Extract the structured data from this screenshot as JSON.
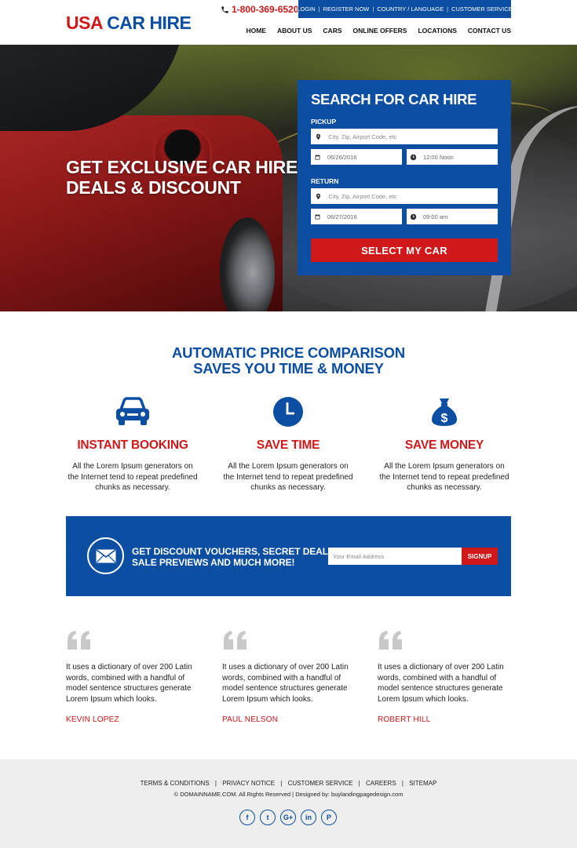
{
  "header": {
    "logo_part1": "USA",
    "logo_part2": "CAR HIRE",
    "phone": "1-800-369-6520",
    "topbar_links": [
      "LOGIN",
      "REGISTER NOW",
      "COUNTRY / LANGUAGE",
      "CUSTOMER SERVICE"
    ],
    "nav": [
      "HOME",
      "ABOUT US",
      "CARS",
      "ONLINE OFFERS",
      "LOCATIONS",
      "CONTACT US"
    ]
  },
  "hero": {
    "headline_line1": "GET EXCLUSIVE CAR HIRE",
    "headline_line2": "DEALS & DISCOUNT"
  },
  "search": {
    "title": "SEARCH FOR CAR HIRE",
    "pickup_label": "PICKUP",
    "pickup_location_placeholder": "City, Zip, Airport Code, etc",
    "pickup_date": "06/26/2016",
    "pickup_time": "12:00 Noon",
    "return_label": "RETURN",
    "return_location_placeholder": "City, Zip, Airport Code, etc",
    "return_date": "06/27/2016",
    "return_time": "09:00 am",
    "button": "SELECT MY CAR"
  },
  "features": {
    "title_line1": "AUTOMATIC PRICE COMPARISON",
    "title_line2": "SAVES YOU TIME & MONEY",
    "items": [
      {
        "icon": "car-icon",
        "title": "INSTANT BOOKING",
        "text": "All the Lorem Ipsum generators on the Internet tend to repeat predefined chunks as necessary."
      },
      {
        "icon": "clock-icon",
        "title": "SAVE TIME",
        "text": "All the Lorem Ipsum generators on the Internet tend to repeat predefined chunks as necessary."
      },
      {
        "icon": "money-bag-icon",
        "title": "SAVE MONEY",
        "text": "All the Lorem Ipsum generators on the Internet tend to repeat predefined chunks as necessary."
      }
    ]
  },
  "newsletter": {
    "text_line1": "GET DISCOUNT VOUCHERS, SECRET DEALS,",
    "text_line2": "SALE PREVIEWS AND MUCH MORE!",
    "email_placeholder": "Your Email Address",
    "button": "SIGNUP"
  },
  "testimonials": [
    {
      "text": "It uses a dictionary of over 200 Latin words, combined with a handful of model sentence structures  generate Lorem Ipsum which looks.",
      "name": "KEVIN LOPEZ"
    },
    {
      "text": "It uses a dictionary of over 200 Latin words, combined with a handful of model sentence structures  generate Lorem Ipsum which looks.",
      "name": "PAUL NELSON"
    },
    {
      "text": "It uses a dictionary of over 200 Latin words, combined with a handful of model sentence structures  generate Lorem Ipsum which looks.",
      "name": "ROBERT HILL"
    }
  ],
  "footer": {
    "links": [
      "TERMS & CONDITIONS",
      "PRIVACY NOTICE",
      "CUSTOMER SERVICE",
      "CAREERS",
      "SITEMAP"
    ],
    "copyright": "© DOMAINNAME.COM. All Rights Reserved | Designed by: buylandingpagedesign.com",
    "social": [
      {
        "icon": "facebook-icon",
        "glyph": "f"
      },
      {
        "icon": "twitter-icon",
        "glyph": "t"
      },
      {
        "icon": "google-plus-icon",
        "glyph": "G+"
      },
      {
        "icon": "linkedin-icon",
        "glyph": "in"
      },
      {
        "icon": "pinterest-icon",
        "glyph": "P"
      }
    ]
  },
  "colors": {
    "brand_blue": "#0b4ea2",
    "brand_red": "#d0181a",
    "footer_bg": "#eeeeee"
  }
}
